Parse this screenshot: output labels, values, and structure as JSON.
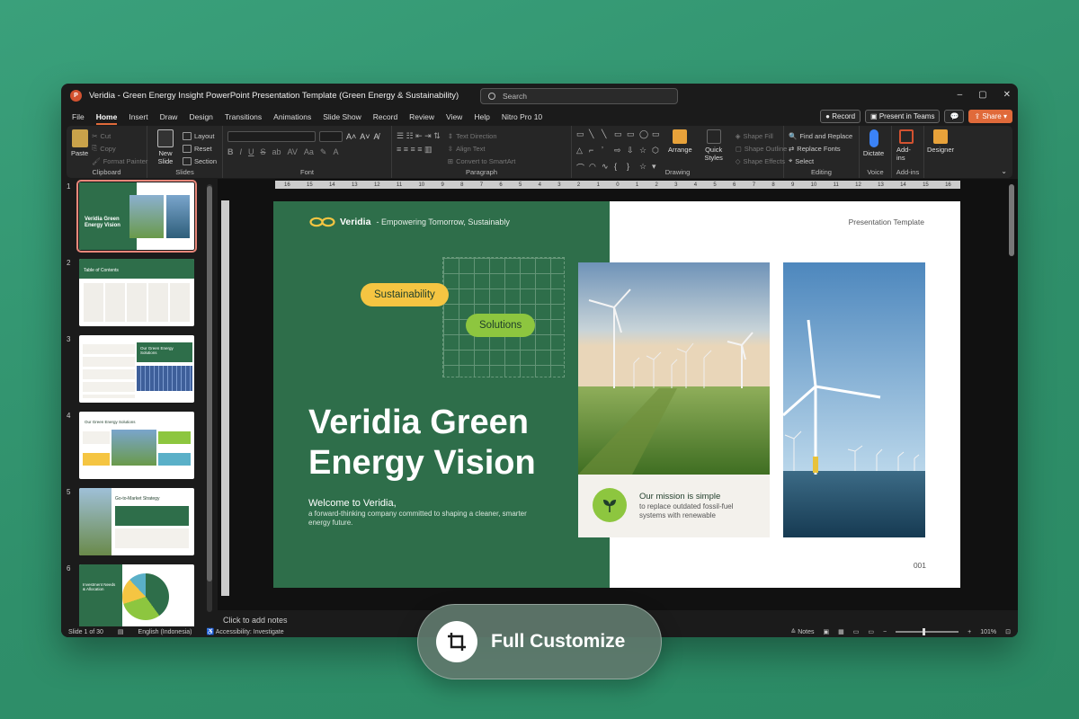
{
  "window": {
    "title": "Veridia - Green Energy Insight PowerPoint Presentation Template (Green Energy & Sustainability)",
    "search_placeholder": "Search",
    "controls": [
      "–",
      "▢",
      "✕"
    ]
  },
  "menu": {
    "tabs": [
      "File",
      "Home",
      "Insert",
      "Draw",
      "Design",
      "Transitions",
      "Animations",
      "Slide Show",
      "Record",
      "Review",
      "View",
      "Help",
      "Nitro Pro 10"
    ],
    "active": "Home",
    "record_label": "Record",
    "present_label": "Present in Teams",
    "share_label": "Share"
  },
  "ribbon": {
    "clipboard": {
      "paste": "Paste",
      "cut": "Cut",
      "copy": "Copy",
      "format_painter": "Format Painter",
      "label": "Clipboard"
    },
    "slides": {
      "new_slide": "New Slide",
      "layout": "Layout",
      "reset": "Reset",
      "section": "Section",
      "label": "Slides"
    },
    "font": {
      "label": "Font"
    },
    "paragraph": {
      "text_direction": "Text Direction",
      "align_text": "Align Text",
      "convert": "Convert to SmartArt",
      "label": "Paragraph"
    },
    "drawing": {
      "arrange": "Arrange",
      "quick_styles": "Quick Styles",
      "shape_fill": "Shape Fill",
      "shape_outline": "Shape Outline",
      "shape_effects": "Shape Effects",
      "label": "Drawing"
    },
    "editing": {
      "find": "Find and Replace",
      "replace_fonts": "Replace Fonts",
      "select": "Select",
      "label": "Editing"
    },
    "voice": {
      "dictate": "Dictate",
      "label": "Voice"
    },
    "addins": {
      "addins": "Add-ins",
      "label": "Add-ins"
    },
    "designer": {
      "label": "Designer"
    }
  },
  "thumbnails": [
    {
      "num": "1",
      "title": "Veridia Green Energy Vision",
      "selected": true
    },
    {
      "num": "2",
      "title": "Table of Contents"
    },
    {
      "num": "3",
      "title": "Our Green Energy Solutions"
    },
    {
      "num": "4",
      "title": "Our Green Energy Solutions"
    },
    {
      "num": "5",
      "title": "Go-to-Market Strategy"
    },
    {
      "num": "6",
      "title": "Investment Needs & Allocation"
    }
  ],
  "ruler": {
    "ticks": [
      "16",
      "15",
      "14",
      "13",
      "12",
      "11",
      "10",
      "9",
      "8",
      "7",
      "6",
      "5",
      "4",
      "3",
      "2",
      "1",
      "0",
      "1",
      "2",
      "3",
      "4",
      "5",
      "6",
      "7",
      "8",
      "9",
      "10",
      "11",
      "12",
      "13",
      "14",
      "15",
      "16"
    ]
  },
  "slide": {
    "brand": "Veridia",
    "tagline": "- Empowering Tomorrow, Sustainably",
    "template_label": "Presentation Template",
    "pill1": "Sustainability",
    "pill2": "Solutions",
    "title_line1": "Veridia Green",
    "title_line2": "Energy Vision",
    "welcome": "Welcome to Veridia,",
    "welcome_sub": "a forward-thinking company committed to shaping a cleaner, smarter energy future.",
    "mission_title": "Our mission is simple",
    "mission_text": "to replace outdated fossil-fuel systems with renewable",
    "page_number": "001",
    "colors": {
      "green": "#2e6e4a",
      "yellow": "#f5c542",
      "lime": "#8dc63f"
    }
  },
  "notes_placeholder": "Click to add notes",
  "status": {
    "slide_count": "Slide 1 of 30",
    "language": "English (Indonesia)",
    "accessibility": "Accessibility: Investigate",
    "notes": "Notes",
    "zoom": "101%"
  },
  "badge": {
    "label": "Full Customize"
  }
}
